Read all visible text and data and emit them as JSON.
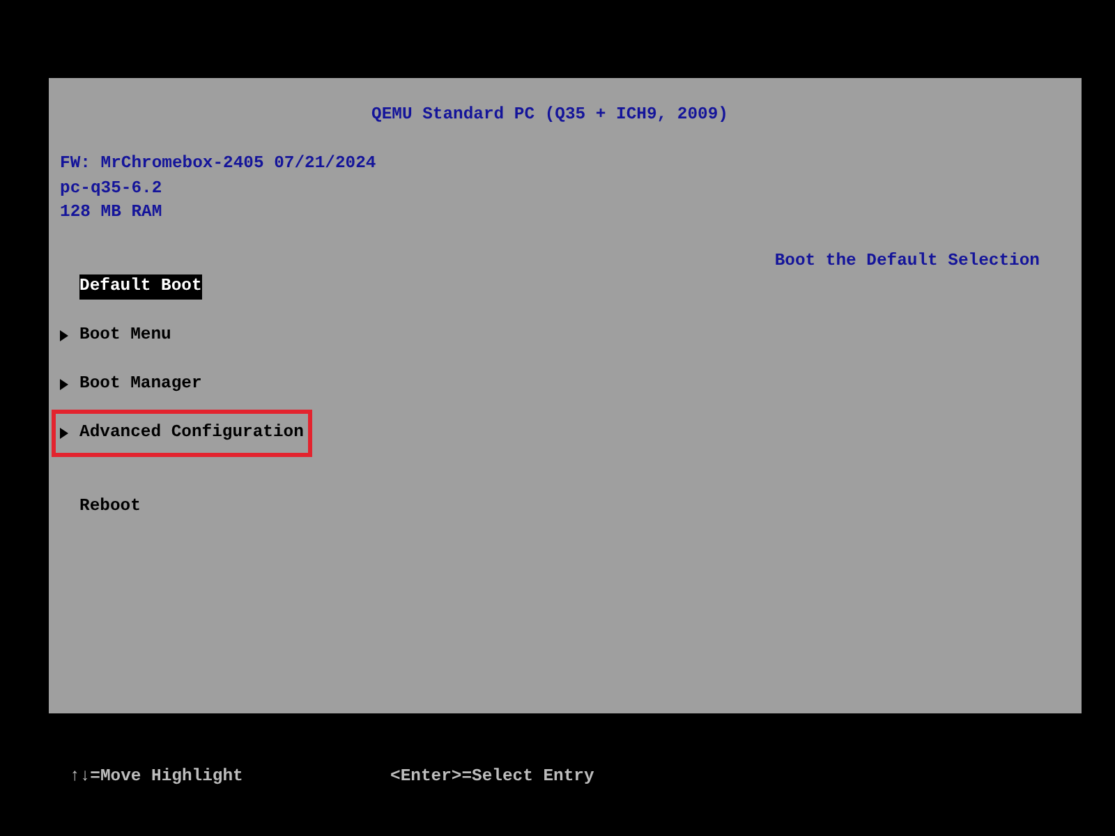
{
  "title": "QEMU Standard PC (Q35 + ICH9, 2009)",
  "info_lines": [
    "FW: MrChromebox-2405 07/21/2024",
    "pc-q35-6.2",
    "128 MB RAM"
  ],
  "help_text": "Boot the Default Selection",
  "menu_groups": [
    {
      "items": [
        {
          "label": "Default Boot",
          "submenu": false,
          "selected": true,
          "outlined": false
        },
        {
          "label": "Boot Menu",
          "submenu": true,
          "selected": false,
          "outlined": false
        },
        {
          "label": "Boot Manager",
          "submenu": true,
          "selected": false,
          "outlined": false
        },
        {
          "label": "Advanced Configuration",
          "submenu": true,
          "selected": false,
          "outlined": true
        }
      ]
    },
    {
      "items": [
        {
          "label": "Reboot",
          "submenu": false,
          "selected": false,
          "outlined": false
        }
      ]
    }
  ],
  "footer": [
    "↑↓=Move Highlight",
    "<Enter>=Select Entry"
  ]
}
